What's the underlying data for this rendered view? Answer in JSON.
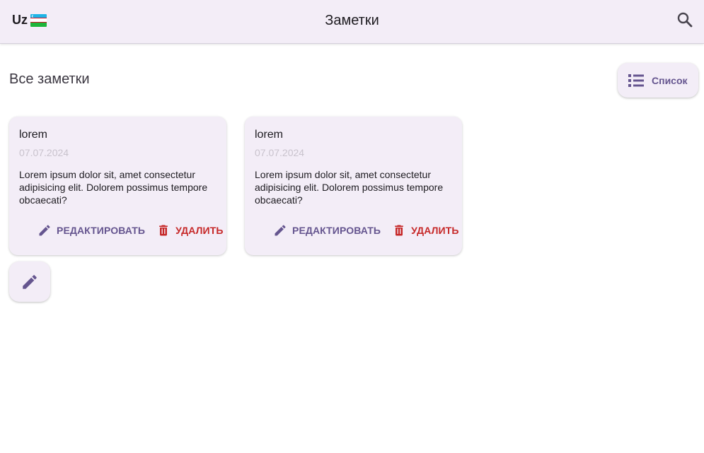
{
  "appbar": {
    "lang_code": "Uz",
    "flag_icon": "uzbekistan-flag-icon",
    "title": "Заметки",
    "search_icon": "search-icon"
  },
  "main": {
    "section_title": "Все заметки",
    "view_toggle": {
      "label": "Список",
      "icon": "list-icon"
    }
  },
  "notes": [
    {
      "title": "lorem",
      "date": "07.07.2024",
      "text": "Lorem ipsum dolor sit, amet consectetur adipisicing elit. Dolorem possimus tempore obcaecati?",
      "edit_label": "РЕДАКТИРОВАТЬ",
      "delete_label": "УДАЛИТЬ"
    },
    {
      "title": "lorem",
      "date": "07.07.2024",
      "text": "Lorem ipsum dolor sit, amet consectetur adipisicing elit. Dolorem possimus tempore obcaecati?",
      "edit_label": "РЕДАКТИРОВАТЬ",
      "delete_label": "УДАЛИТЬ"
    }
  ],
  "fab": {
    "icon": "pencil-icon"
  },
  "colors": {
    "surface": "#f3edf7",
    "primary": "#65558f",
    "danger": "#c62828",
    "date_text": "#c9c3cd"
  }
}
